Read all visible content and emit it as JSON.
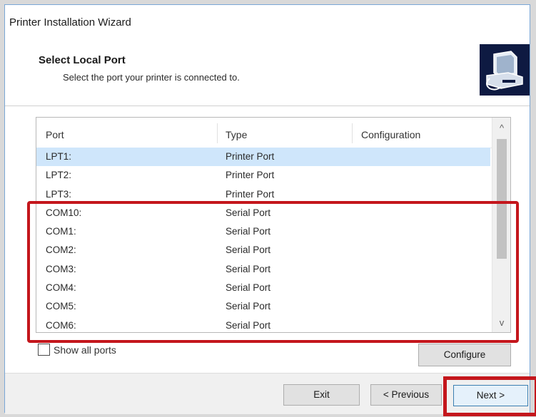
{
  "window": {
    "title": "Printer Installation Wizard"
  },
  "header": {
    "title": "Select Local Port",
    "subtitle": "Select the port your printer is connected to.",
    "logo_icon": "printer-computer-icon"
  },
  "port_list": {
    "columns": [
      "Port",
      "Type",
      "Configuration"
    ],
    "rows": [
      {
        "port": "LPT1:",
        "type": "Printer Port",
        "configuration": "",
        "selected": true
      },
      {
        "port": "LPT2:",
        "type": "Printer Port",
        "configuration": ""
      },
      {
        "port": "LPT3:",
        "type": "Printer Port",
        "configuration": ""
      },
      {
        "port": "COM10:",
        "type": "Serial Port",
        "configuration": ""
      },
      {
        "port": "COM1:",
        "type": "Serial Port",
        "configuration": ""
      },
      {
        "port": "COM2:",
        "type": "Serial Port",
        "configuration": ""
      },
      {
        "port": "COM3:",
        "type": "Serial Port",
        "configuration": ""
      },
      {
        "port": "COM4:",
        "type": "Serial Port",
        "configuration": ""
      },
      {
        "port": "COM5:",
        "type": "Serial Port",
        "configuration": ""
      },
      {
        "port": "COM6:",
        "type": "Serial Port",
        "configuration": ""
      }
    ],
    "scroll_up_glyph": "^",
    "scroll_down_glyph": "v"
  },
  "options": {
    "show_all_ports_label": "Show all ports",
    "show_all_ports_checked": false,
    "configure_label": "Configure"
  },
  "footer": {
    "exit_label": "Exit",
    "previous_label": "< Previous",
    "next_label": "Next >"
  },
  "colors": {
    "highlight_annotation": "#c4161c",
    "selected_row": "#cfe6fb",
    "logo_background": "#0e1a42"
  }
}
